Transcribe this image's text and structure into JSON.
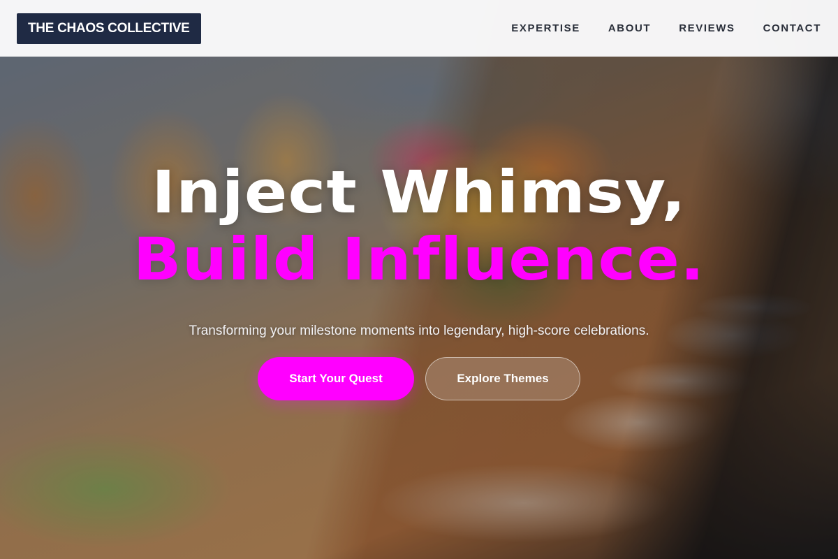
{
  "brand": {
    "logo_text": "THE CHAOS COLLECTIVE"
  },
  "nav": {
    "items": [
      {
        "label": "EXPERTISE"
      },
      {
        "label": "ABOUT"
      },
      {
        "label": "REVIEWS"
      },
      {
        "label": "CONTACT"
      }
    ]
  },
  "hero": {
    "headline_line1": "Inject Whimsy,",
    "headline_line2": "Build Influence.",
    "subtitle": "Transforming your milestone moments into legendary, high-score celebrations.",
    "primary_cta": "Start Your Quest",
    "secondary_cta": "Explore Themes",
    "background_image": "blurred banquet table with floral centerpiece"
  },
  "colors": {
    "accent": "#ff00ff",
    "logo_bg": "#1f2a44",
    "header_bg": "#fafafb",
    "nav_text": "#2a2f3a"
  }
}
